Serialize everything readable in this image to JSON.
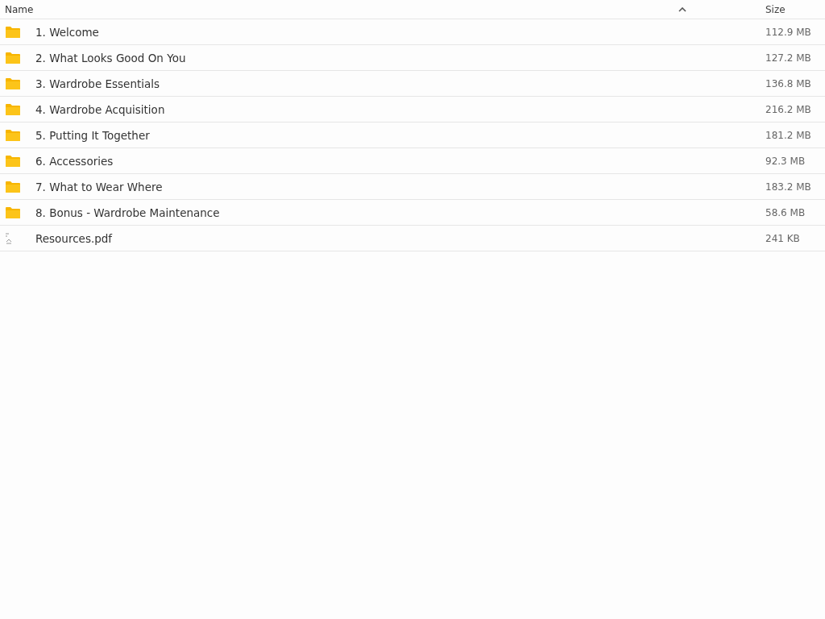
{
  "columns": [
    {
      "label": "Name",
      "sorted": true
    },
    {
      "label": "Size",
      "sorted": false
    }
  ],
  "rows": [
    {
      "kind": "folder",
      "name": "1. Welcome",
      "size": "112.9 MB"
    },
    {
      "kind": "folder",
      "name": "2. What Looks Good On You",
      "size": "127.2 MB"
    },
    {
      "kind": "folder",
      "name": "3. Wardrobe Essentials",
      "size": "136.8 MB"
    },
    {
      "kind": "folder",
      "name": "4. Wardrobe Acquisition",
      "size": "216.2 MB"
    },
    {
      "kind": "folder",
      "name": "5. Putting It Together",
      "size": "181.2 MB"
    },
    {
      "kind": "folder",
      "name": "6. Accessories",
      "size": "92.3 MB"
    },
    {
      "kind": "folder",
      "name": "7. What to Wear Where",
      "size": "183.2 MB"
    },
    {
      "kind": "folder",
      "name": "8. Bonus - Wardrobe Maintenance",
      "size": "58.6 MB"
    },
    {
      "kind": "file",
      "name": "Resources.pdf",
      "size": "241 KB"
    }
  ]
}
